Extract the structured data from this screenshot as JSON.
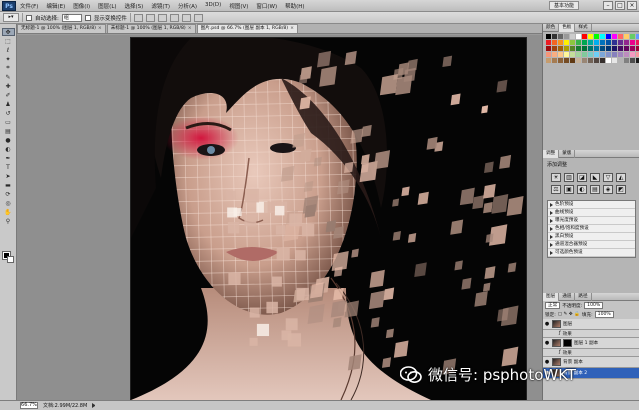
{
  "app": {
    "logo_text": "Ps"
  },
  "menu": {
    "items": [
      "文件(F)",
      "编辑(E)",
      "图像(I)",
      "图层(L)",
      "选择(S)",
      "滤镜(T)",
      "分析(A)",
      "3D(D)",
      "视图(V)",
      "窗口(W)",
      "帮助(H)"
    ],
    "workspace": "基本功能"
  },
  "options_bar": {
    "auto_select_label": "自动选择:",
    "auto_select_value": "组",
    "show_transform_label": "显示变换控件"
  },
  "tabs": [
    {
      "label": "无标题-1 @ 100% (图层 1, RGB/8)",
      "active": false
    },
    {
      "label": "未标题-1 @ 100% (图层 1, RGB/8)",
      "active": false
    },
    {
      "label": "图片.psd @ 66.7% (图层 副本 1, RGB/8)",
      "active": true
    }
  ],
  "status_bar": {
    "zoom": "66.7%",
    "doc_info": "文档:2.99M/22.8M"
  },
  "swatch_panel": {
    "tabs": [
      "颜色",
      "色板",
      "样式"
    ],
    "colors": [
      "#000000",
      "#333333",
      "#666666",
      "#999999",
      "#cccccc",
      "#ffffff",
      "#ff0000",
      "#ffff00",
      "#00ff00",
      "#00ffff",
      "#0000ff",
      "#ff00ff",
      "#ff6666",
      "#ffcc66",
      "#66cc66",
      "#6699ff",
      "#ed1c24",
      "#f26522",
      "#f7941d",
      "#fff200",
      "#8dc63f",
      "#39b54a",
      "#00a651",
      "#00a99d",
      "#00aeef",
      "#0072bc",
      "#0054a6",
      "#2e3192",
      "#662d91",
      "#92278f",
      "#ec008c",
      "#ed145b",
      "#9e0b0f",
      "#a0410d",
      "#a36209",
      "#aba000",
      "#598527",
      "#197b30",
      "#007236",
      "#00746b",
      "#0076a3",
      "#004b80",
      "#003471",
      "#1b1464",
      "#440e62",
      "#630460",
      "#9e005d",
      "#9e0039",
      "#f69679",
      "#f9ad81",
      "#fdc689",
      "#fff799",
      "#c4df9b",
      "#a3d39c",
      "#82ca9c",
      "#7accc8",
      "#6dcff6",
      "#7da7d9",
      "#8393ca",
      "#8781bd",
      "#a186be",
      "#bd8cbf",
      "#f49ac1",
      "#f5989d",
      "#c69c6d",
      "#a67c52",
      "#8c6239",
      "#754c24",
      "#603913",
      "#c7b299",
      "#998675",
      "#736357",
      "#534741",
      "#362f2d",
      "#ffffff",
      "#e6e6e6",
      "#b3b3b3",
      "#808080",
      "#4d4d4d",
      "#1a1a1a"
    ]
  },
  "adjustments_panel": {
    "tabs": [
      "调整",
      "蒙版"
    ],
    "title": "添加调整",
    "icons": [
      "☀",
      "▥",
      "◪",
      "◣",
      "▽",
      "◭",
      "⚖",
      "▣",
      "◐",
      "▤",
      "◈",
      "◩"
    ],
    "presets": [
      "色阶预设",
      "曲线预设",
      "曝光度预设",
      "色相/饱和度预设",
      "黑白预设",
      "通道混合器预设",
      "可选颜色预设"
    ]
  },
  "layers_panel": {
    "tabs": [
      "图层",
      "通道",
      "路径"
    ],
    "blend_mode": "正常",
    "opacity_label": "不透明度:",
    "opacity_value": "100%",
    "lock_label": "锁定:",
    "fill_label": "填充:",
    "fill_value": "100%",
    "rows": [
      {
        "name": "图层",
        "kind": "layer",
        "selected": false
      },
      {
        "name": "效果",
        "kind": "sub",
        "selected": false
      },
      {
        "name": "图层 1 副本",
        "kind": "layer",
        "selected": false
      },
      {
        "name": "效果",
        "kind": "sub",
        "selected": false
      },
      {
        "name": "背景 副本",
        "kind": "layer",
        "selected": false
      },
      {
        "name": "背景 副本 2",
        "kind": "layer",
        "selected": true
      }
    ]
  },
  "watermark": {
    "text": "微信号: psphotoWKT"
  }
}
